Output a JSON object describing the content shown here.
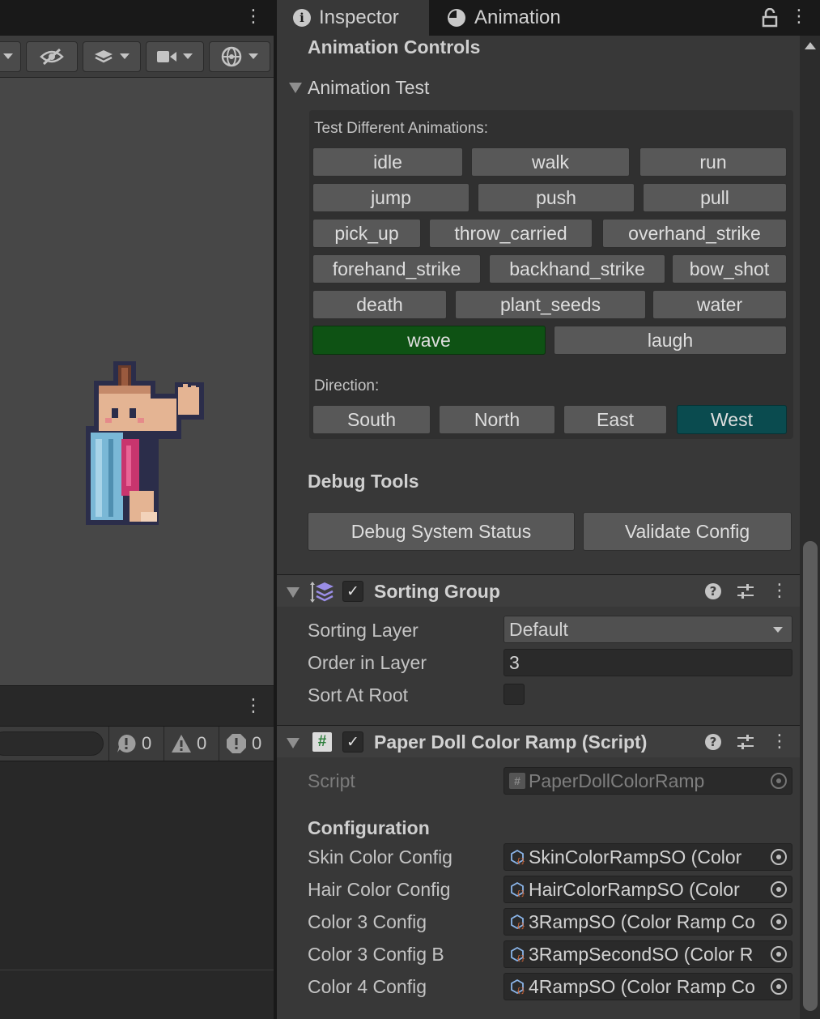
{
  "left_panel": {
    "console": {
      "counts": {
        "info": "0",
        "warning": "0",
        "error": "0"
      }
    },
    "sprite_colors": {
      "skin": "#e4b493",
      "cloak": "#7ab8d6",
      "dress": "#c8356e",
      "hair": "#6a3b2a",
      "outline": "#2b2d4a"
    }
  },
  "inspector": {
    "tabs": [
      {
        "label": "Inspector",
        "icon": "info-icon"
      },
      {
        "label": "Animation",
        "icon": "clock-icon"
      }
    ],
    "animation_controls": {
      "section_title": "Animation Controls",
      "foldout_label": "Animation Test",
      "test_label": "Test Different Animations:",
      "animations": [
        "idle",
        "walk",
        "run",
        "jump",
        "push",
        "pull",
        "pick_up",
        "throw_carried",
        "overhand_strike",
        "forehand_strike",
        "backhand_strike",
        "bow_shot",
        "death",
        "plant_seeds",
        "water",
        "wave",
        "laugh"
      ],
      "active_animation": "wave",
      "direction_label": "Direction:",
      "directions": [
        "South",
        "North",
        "East",
        "West"
      ],
      "active_direction": "West",
      "active_colors": {
        "animation": "#0e5214",
        "direction": "#0a4b4f"
      }
    },
    "debug_tools": {
      "title": "Debug Tools",
      "status_button": "Debug System Status",
      "validate_button": "Validate Config"
    },
    "sorting_group": {
      "title": "Sorting Group",
      "enabled": true,
      "sorting_layer_label": "Sorting Layer",
      "sorting_layer_value": "Default",
      "order_label": "Order in Layer",
      "order_value": "3",
      "sort_at_root_label": "Sort At Root",
      "sort_at_root": false
    },
    "color_ramp_script": {
      "title": "Paper Doll Color Ramp (Script)",
      "enabled": true,
      "script_label": "Script",
      "script_value": "PaperDollColorRamp",
      "configuration_title": "Configuration",
      "configs": [
        {
          "label": "Skin Color Config",
          "value": "SkinColorRampSO (Color"
        },
        {
          "label": "Hair Color Config",
          "value": "HairColorRampSO (Color"
        },
        {
          "label": "Color 3 Config",
          "value": "3RampSO (Color Ramp Co"
        },
        {
          "label": "Color 3 Config B",
          "value": "3RampSecondSO (Color R"
        },
        {
          "label": "Color 4 Config",
          "value": "4RampSO (Color Ramp Co"
        }
      ]
    }
  }
}
